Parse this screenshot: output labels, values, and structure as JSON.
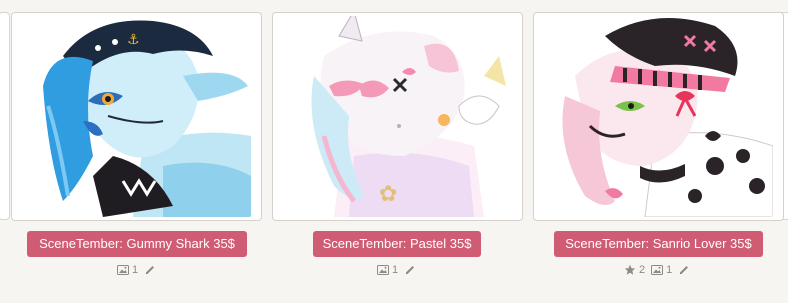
{
  "gallery": {
    "items": [
      {
        "title": "SceneTember: Gummy Shark 35$",
        "stars": "",
        "image_count": "1",
        "accent": "#4aa3e8"
      },
      {
        "title": "SceneTember: Pastel 35$",
        "stars": "",
        "image_count": "1",
        "accent": "#f4a9c3"
      },
      {
        "title": "SceneTember: Sanrio Lover 35$",
        "stars": "2",
        "image_count": "1",
        "accent": "#2a2327"
      }
    ]
  },
  "colors": {
    "button_bg": "#cf5c73",
    "button_text": "#ffffff",
    "meta_text": "#8f8a84",
    "page_bg": "#f7f5f1"
  },
  "icons": {
    "image": "image-icon",
    "edit": "pencil-icon",
    "star": "star-icon"
  }
}
